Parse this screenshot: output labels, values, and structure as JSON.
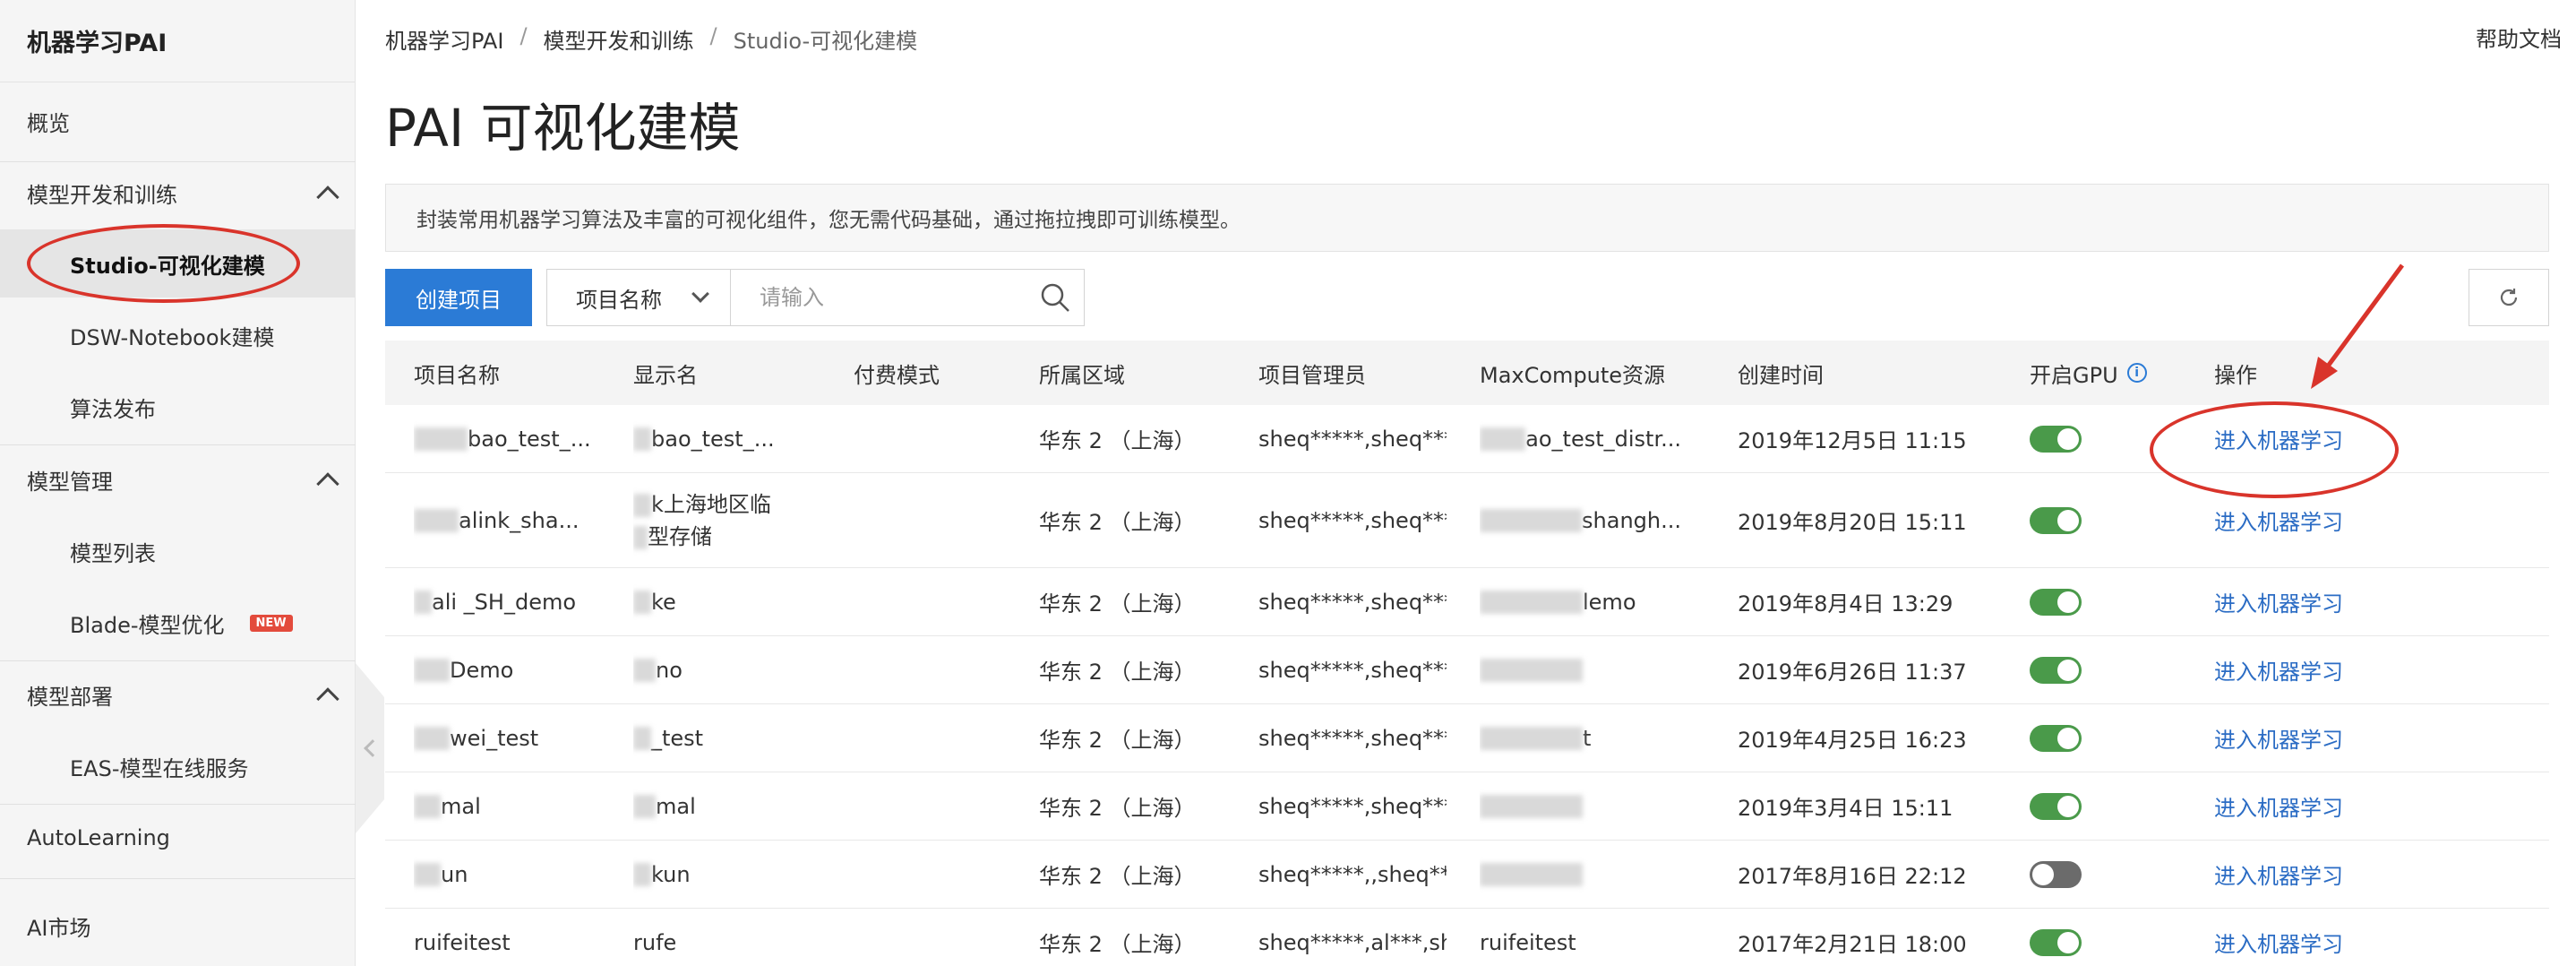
{
  "app": {
    "brand": "机器学习PAI",
    "help": "帮助文档"
  },
  "sidebar": {
    "overview": "概览",
    "group_dev": "模型开发和训练",
    "studio": "Studio-可视化建模",
    "dsw": "DSW-Notebook建模",
    "algo": "算法发布",
    "group_mgmt": "模型管理",
    "model_list": "模型列表",
    "blade": "Blade-模型优化",
    "new_badge": "NEW",
    "group_deploy": "模型部署",
    "eas": "EAS-模型在线服务",
    "autolearning": "AutoLearning",
    "ai_market": "AI市场"
  },
  "breadcrumb": {
    "root": "机器学习PAI",
    "mid": "模型开发和训练",
    "current": "Studio-可视化建模",
    "sep": "/"
  },
  "page": {
    "title": "PAI 可视化建模",
    "description": "封装常用机器学习算法及丰富的可视化组件，您无需代码基础，通过拖拉拽即可训练模型。"
  },
  "toolbar": {
    "create": "创建项目",
    "select_value": "项目名称",
    "search_placeholder": "请输入"
  },
  "table": {
    "headers": {
      "name": "项目名称",
      "display": "显示名",
      "pay": "付费模式",
      "region": "所属区域",
      "admin": "项目管理员",
      "maxcompute": "MaxCompute资源",
      "created": "创建时间",
      "gpu": "开启GPU",
      "ops": "操作"
    },
    "rows": [
      {
        "name": "bao_test_...",
        "display": "bao_test_...",
        "display2": "",
        "region": "华东 2 （上海）",
        "admin": "sheq*****,sheq***",
        "mc": "ao_test_distr...",
        "created": "2019年12月5日 11:15",
        "gpu": "on",
        "action": "进入机器学习"
      },
      {
        "name": "alink_sha...",
        "display": "k上海地区临",
        "display2": "型存储",
        "region": "华东 2 （上海）",
        "admin": "sheq*****,sheq***",
        "mc": "shangh...",
        "created": "2019年8月20日 15:11",
        "gpu": "on",
        "action": "进入机器学习"
      },
      {
        "name": "ali   _SH_demo",
        "display": "ke",
        "display2": "",
        "region": "华东 2 （上海）",
        "admin": "sheq*****,sheq***",
        "mc": "lemo",
        "created": "2019年8月4日 13:29",
        "gpu": "on",
        "action": "进入机器学习"
      },
      {
        "name": "Demo",
        "display": "no",
        "display2": "",
        "region": "华东 2 （上海）",
        "admin": "sheq*****,sheq***",
        "mc": "",
        "created": "2019年6月26日 11:37",
        "gpu": "on",
        "action": "进入机器学习"
      },
      {
        "name": "wei_test",
        "display": "_test",
        "display2": "",
        "region": "华东 2 （上海）",
        "admin": "sheq*****,sheq***",
        "mc": "t",
        "created": "2019年4月25日 16:23",
        "gpu": "on",
        "action": "进入机器学习"
      },
      {
        "name": "mal",
        "display": "mal",
        "display2": "",
        "region": "华东 2 （上海）",
        "admin": "sheq*****,sheq***",
        "mc": "",
        "created": "2019年3月4日 15:11",
        "gpu": "on",
        "action": "进入机器学习"
      },
      {
        "name": "un",
        "display": "kun",
        "display2": "",
        "region": "华东 2 （上海）",
        "admin": "sheq*****,,sheq***",
        "mc": "",
        "created": "2017年8月16日 22:12",
        "gpu": "off",
        "action": "进入机器学习"
      },
      {
        "name": "ruifeitest",
        "display": "rufe",
        "display2": "",
        "region": "华东 2 （上海）",
        "admin": "sheq*****,al***,she",
        "mc": "ruifeitest",
        "created": "2017年2月21日 18:00",
        "gpu": "on",
        "action": "进入机器学习"
      }
    ]
  },
  "colors": {
    "primary": "#2b7bd6",
    "annotation": "#d9342b",
    "toggle_on": "#4a9a4a"
  }
}
